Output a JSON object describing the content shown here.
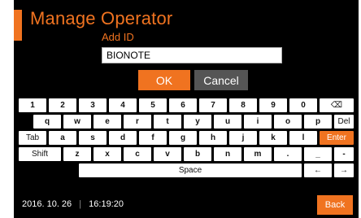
{
  "header": {
    "title": "Manage Operator"
  },
  "form": {
    "label": "Add ID",
    "value": "BIONOTE"
  },
  "buttons": {
    "ok": "OK",
    "cancel": "Cancel",
    "back": "Back"
  },
  "keyboard": {
    "row1": [
      "1",
      "2",
      "3",
      "4",
      "5",
      "6",
      "7",
      "8",
      "9",
      "0",
      "⌫"
    ],
    "row2": [
      "q",
      "w",
      "e",
      "r",
      "t",
      "y",
      "u",
      "i",
      "o",
      "p",
      "Del"
    ],
    "row3": [
      "Tab",
      "a",
      "s",
      "d",
      "f",
      "g",
      "h",
      "j",
      "k",
      "l",
      "Enter"
    ],
    "row4": [
      "Shift",
      "z",
      "x",
      "c",
      "v",
      "b",
      "n",
      "m",
      ".",
      "_",
      "-"
    ],
    "row5": [
      "Space",
      "←",
      "→"
    ]
  },
  "status": {
    "date": "2016. 10. 26",
    "separator": "|",
    "time": "16:19:20"
  },
  "colors": {
    "accent": "#f07320",
    "background": "#000000",
    "cancel": "#555555"
  }
}
